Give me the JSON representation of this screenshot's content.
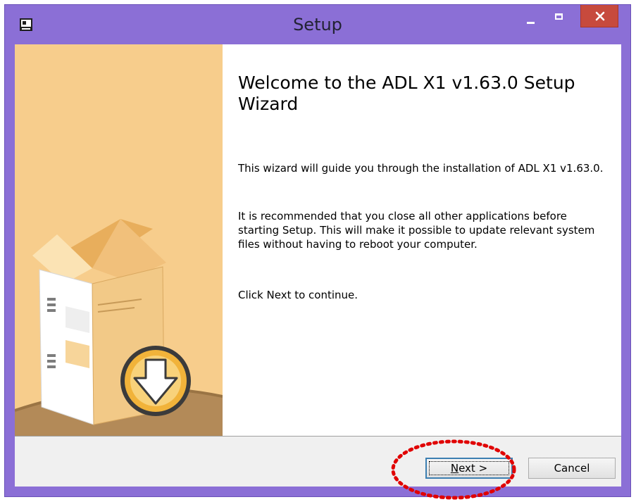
{
  "window": {
    "title": "Setup",
    "accent_color": "#8b6fd6",
    "close_color": "#c74a3d"
  },
  "titlebar": {
    "app_icon": "installer-icon",
    "minimize_icon": "minimize-icon",
    "maximize_icon": "maximize-icon",
    "close_icon": "close-icon"
  },
  "sidebar": {
    "image": "package-download-illustration",
    "background_color": "#f7cd8c"
  },
  "main": {
    "heading": "Welcome to the ADL X1 v1.63.0 Setup Wizard",
    "paragraphs": [
      "This wizard will guide you through the installation of ADL X1 v1.63.0.",
      "It is recommended that you close all other applications before starting Setup. This will make it possible to update relevant system files without having to reboot your computer.",
      "Click Next to continue."
    ]
  },
  "footer": {
    "next_label_mnemonic": "N",
    "next_label_rest": "ext >",
    "cancel_label": "Cancel"
  },
  "annotation": {
    "shape": "dotted-ellipse",
    "color": "#e00000"
  }
}
